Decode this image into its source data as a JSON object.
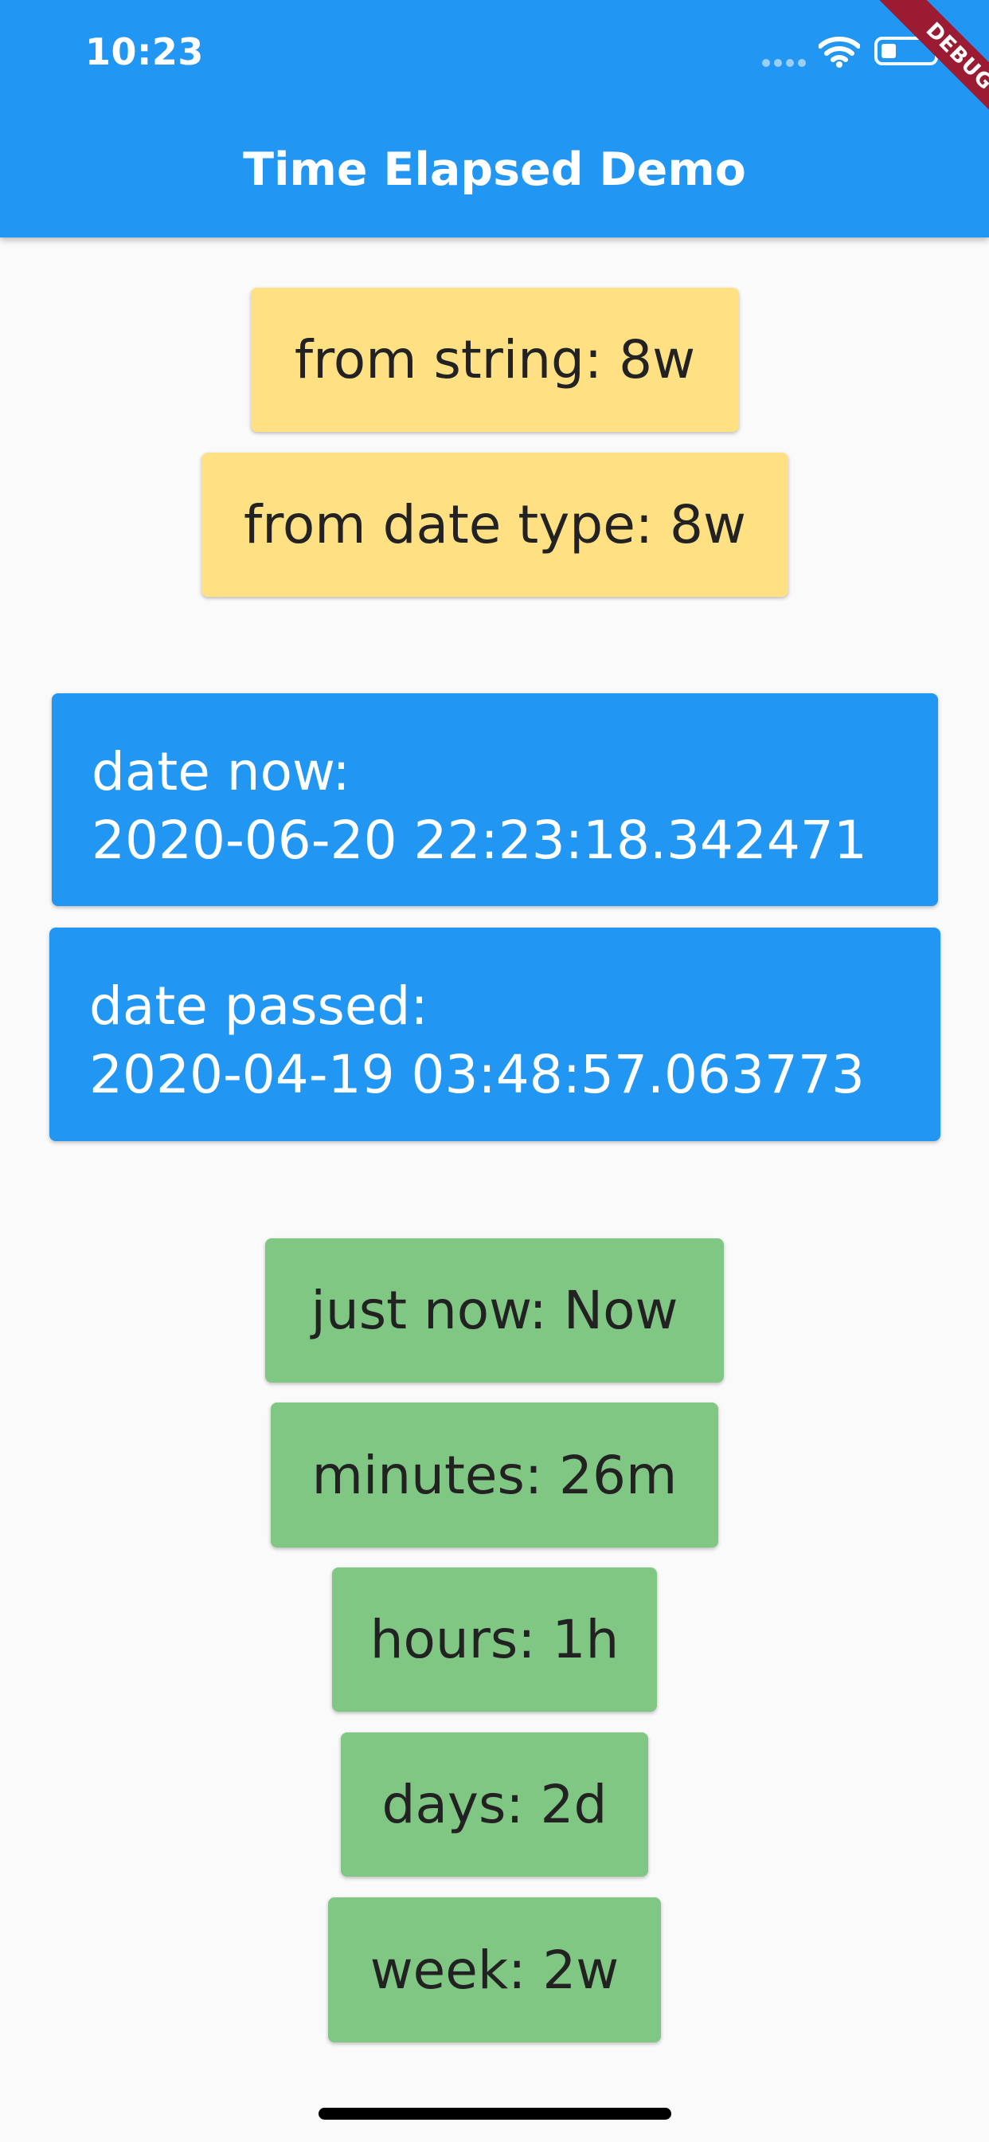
{
  "status_bar": {
    "time": "10:23"
  },
  "app_bar": {
    "title": "Time Elapsed Demo",
    "debug_banner": "DEBUG"
  },
  "yellow_cards": [
    {
      "label": "from string: 8w"
    },
    {
      "label": "from date type: 8w"
    }
  ],
  "blue_cards": [
    {
      "heading": "date now:",
      "value": "2020-06-20 22:23:18.342471"
    },
    {
      "heading": "date passed:",
      "value": "2020-04-19 03:48:57.063773"
    }
  ],
  "green_cards": [
    {
      "label": "just now: Now"
    },
    {
      "label": "minutes: 26m"
    },
    {
      "label": "hours: 1h"
    },
    {
      "label": "days: 2d"
    },
    {
      "label": "week: 2w"
    }
  ],
  "colors": {
    "app_bar": "#2196f3",
    "yellow_card": "#ffe082",
    "blue_card": "#2196f3",
    "green_card": "#81c784",
    "debug_banner": "#9a1b32"
  }
}
